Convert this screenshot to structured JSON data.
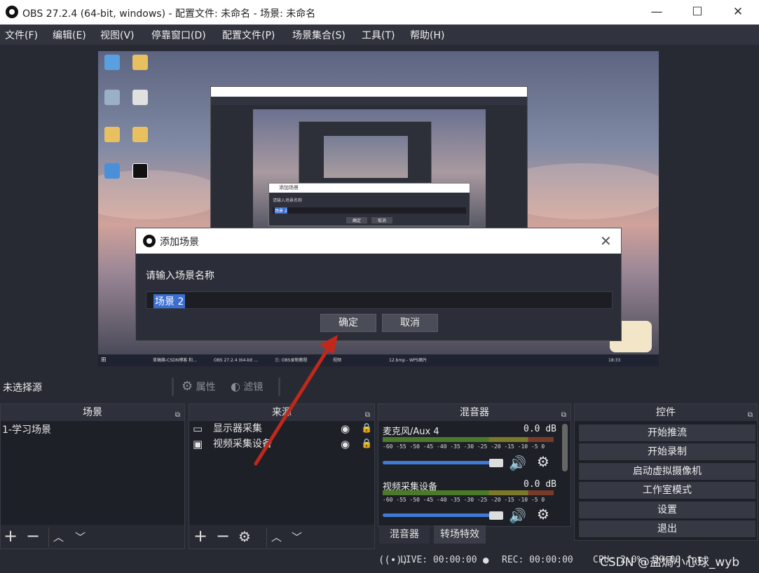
{
  "window": {
    "title": "OBS 27.2.4 (64-bit, windows) - 配置文件: 未命名 - 场景: 未命名",
    "minimize": "—",
    "maximize": "☐",
    "close": "✕"
  },
  "menu": [
    "文件(F)",
    "编辑(E)",
    "视图(V)",
    "停靠窗口(D)",
    "配置文件(P)",
    "场景集合(S)",
    "工具(T)",
    "帮助(H)"
  ],
  "dialog": {
    "title": "添加场景",
    "prompt": "请输入场景名称",
    "input_value": "场景 2",
    "ok": "确定",
    "cancel": "取消",
    "close": "✕"
  },
  "preview": {
    "nested_dialog_title": "添加场景",
    "nested_prompt": "请输入场景名称",
    "nested_input": "场景 2",
    "nested_ok": "确定",
    "nested_cancel": "取消",
    "taskbar": {
      "items": [
        "草稿箱-CSDN博客 和...",
        "OBS 27.2.4 (64-bit ...",
        "三: OBS录制教程",
        "视频",
        "12.bmp - WPS图片"
      ],
      "clock": "18:33"
    }
  },
  "source_toolbar": {
    "no_source": "未选择源",
    "properties": "属性",
    "filters": "滤镜"
  },
  "scenes": {
    "title": "场景",
    "items": [
      "1-学习场景"
    ]
  },
  "sources": {
    "title": "来源",
    "items": [
      {
        "name": "显示器采集",
        "icon": "monitor-icon"
      },
      {
        "name": "视频采集设备",
        "icon": "camera-icon"
      }
    ]
  },
  "mixer": {
    "title": "混音器",
    "tracks": [
      {
        "name": "麦克风/Aux 4",
        "db": "0.0 dB"
      },
      {
        "name": "视频采集设备",
        "db": "0.0 dB"
      }
    ],
    "ticks": "-60 -55 -50 -45 -40 -35 -30 -25 -20 -15 -10  -5  0",
    "tabs": [
      "混音器",
      "转场特效"
    ]
  },
  "controls": {
    "title": "控件",
    "buttons": [
      "开始推流",
      "开始录制",
      "启动虚拟摄像机",
      "工作室模式",
      "设置",
      "退出"
    ]
  },
  "status": {
    "live": "LIVE: 00:00:00",
    "rec": "REC: 00:00:00",
    "cpu": "CPU: 2.0%, 30.00 fps"
  },
  "watermark": "CSDN @盐焗小心球_wyb",
  "colors": {
    "arrow": "#c0281c",
    "accent": "#3f7bd6",
    "selection": "#3a6ed0"
  }
}
